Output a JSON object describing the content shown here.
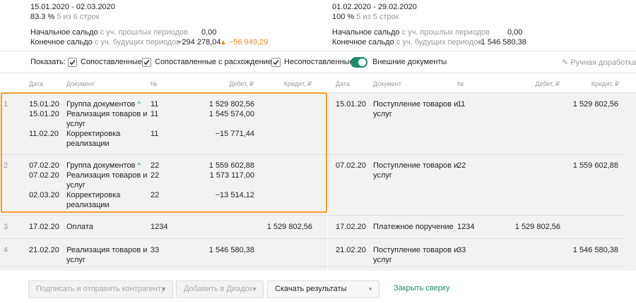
{
  "left_summary": {
    "period": "15.01.2020 - 02.03.2020",
    "percent": "83.3 %",
    "rows_info": "5 из 6 строк",
    "opening_label": "Начальное сальдо",
    "opening_suffix": "с уч. прошлых периодов",
    "opening_value": "0,00",
    "closing_label": "Конечное сальдо",
    "closing_suffix": "с уч. будущих периодов",
    "closing_value": "−294 278,04",
    "closing_diff": "−56 949,29"
  },
  "right_summary": {
    "period": "01.02.2020 - 29.02.2020",
    "percent": "100 %",
    "rows_info": "5 из 5 строк",
    "opening_label": "Начальное сальдо",
    "opening_suffix": "с уч. прошлых периодов",
    "opening_value": "0,00",
    "closing_label": "Конечное сальдо",
    "closing_suffix": "с уч. будущих периодов",
    "closing_value": "-1 546 580,38"
  },
  "filter": {
    "show_label": "Показать:",
    "matched": "Сопоставленные",
    "matched_diff": "Сопоставленные с расхождением",
    "unmatched": "Несопоставленные",
    "external": "Внешние документы",
    "manual": "Ручная доработка"
  },
  "columns": {
    "date": "Дата",
    "document": "Документ",
    "number": "№",
    "debit": "Дебет, ₽",
    "credit": "Кредит, ₽"
  },
  "rows": [
    {
      "num": "1",
      "left": [
        {
          "date": "15.01.20",
          "doc": "Группа документов",
          "caret": "^",
          "no": "11",
          "debit": "1 529 802,56",
          "credit": ""
        },
        {
          "date": "15.01.20",
          "doc1": "Реализация товаров и",
          "doc2": "услуг",
          "no": "11",
          "debit": "1 545 574,00",
          "credit": ""
        },
        {
          "date": "11.02.20",
          "doc1": "Корректировка",
          "doc2": "реализации",
          "no": "11",
          "debit": "−15 771,44",
          "credit": ""
        }
      ],
      "right": {
        "date": "15.01.20",
        "doc1": "Поступление товаров и",
        "doc2": "услуг",
        "no": "11",
        "debit": "",
        "credit": "1 529 802,56"
      }
    },
    {
      "num": "2",
      "left": [
        {
          "date": "07.02.20",
          "doc": "Группа документов",
          "caret": "^",
          "no": "22",
          "debit": "1 559 602,88",
          "credit": ""
        },
        {
          "date": "07.02.20",
          "doc1": "Реализация товаров и",
          "doc2": "услуг",
          "no": "22",
          "debit": "1 573 117,00",
          "credit": ""
        },
        {
          "date": "02.03.20",
          "doc1": "Корректировка",
          "doc2": "реализации",
          "no": "22",
          "debit": "−13 514,12",
          "credit": ""
        }
      ],
      "right": {
        "date": "07.02.20",
        "doc1": "Поступление товаров и",
        "doc2": "услуг",
        "no": "22",
        "debit": "",
        "credit": "1 559 602,88"
      }
    },
    {
      "num": "3",
      "left": {
        "date": "17.02.20",
        "doc": "Оплата",
        "no": "1234",
        "debit": "",
        "credit": "1 529 802,56"
      },
      "right": {
        "date": "17.02.20",
        "doc": "Платежное поручение",
        "no": "1234",
        "debit": "1 529 802,56",
        "credit": ""
      }
    },
    {
      "num": "4",
      "left": {
        "date": "21.02.20",
        "doc1": "Реализация товаров и",
        "doc2": "услуг",
        "no": "33",
        "debit": "1 546 580,38",
        "credit": ""
      },
      "right": {
        "date": "21.02.20",
        "doc1": "Поступление товаров и",
        "doc2": "услуг",
        "no": "33",
        "debit": "",
        "credit": "1 546 580,38"
      }
    }
  ],
  "footer": {
    "sign_send": "Подписать и отправить контрагенту",
    "add_diadoc": "Добавить в Диадок",
    "download": "Скачать результаты сверки",
    "close": "Закрыть сверку"
  },
  "icons": {
    "warning": "warning-triangle-icon",
    "pencil": "pencil-icon",
    "check": "checkmark-icon",
    "dropdown": "chevron-down-icon"
  },
  "colors": {
    "accent_green": "#1c8b6a",
    "highlight_orange": "#f29f22",
    "warning_orange": "#e8891b"
  }
}
